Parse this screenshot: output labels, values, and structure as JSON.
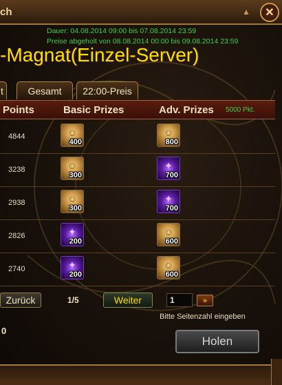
{
  "window": {
    "title": "ch",
    "close_icon": "close-icon"
  },
  "event": {
    "duration": "Dauer: 04.08.2014 09:00 bis 07.08.2014 23:59",
    "claim_period": "Preise abgeholt von 08.08.2014 00:00 bis 09.08.2014 23:59",
    "title": "-Magnat(Einzel-Server)"
  },
  "tabs": [
    {
      "label": "t"
    },
    {
      "label": "Gesamt"
    },
    {
      "label": "22:00-Preis"
    }
  ],
  "table": {
    "headers": {
      "points": "Points",
      "basic": "Basic Prizes",
      "adv": "Adv. Prizes",
      "adv_threshold": "5000 Pkt."
    },
    "rows": [
      {
        "points": "4844",
        "basic": {
          "kind": "gold-scroll",
          "qty": "400"
        },
        "adv": {
          "kind": "gold-scroll",
          "qty": "800"
        }
      },
      {
        "points": "3238",
        "basic": {
          "kind": "gold-scroll",
          "qty": "300"
        },
        "adv": {
          "kind": "purple-orb",
          "qty": "700"
        }
      },
      {
        "points": "2938",
        "basic": {
          "kind": "gold-scroll",
          "qty": "300"
        },
        "adv": {
          "kind": "purple-orb",
          "qty": "700"
        }
      },
      {
        "points": "2826",
        "basic": {
          "kind": "purple-orb",
          "qty": "200"
        },
        "adv": {
          "kind": "gold-scroll",
          "qty": "600"
        }
      },
      {
        "points": "2740",
        "basic": {
          "kind": "purple-orb",
          "qty": "200"
        },
        "adv": {
          "kind": "gold-scroll",
          "qty": "600"
        }
      }
    ]
  },
  "pagination": {
    "back_label": "Zurück",
    "page_indicator": "1/5",
    "next_label": "Weiter",
    "page_input_value": "1",
    "go_label": "»",
    "hint": "Bitte Seitenzahl eingeben"
  },
  "my_points": "0",
  "claim_label": "Holen",
  "colors": {
    "info_text": "#3fcf3f",
    "title": "#ffde00",
    "header_bg": "#5a1c0f"
  }
}
